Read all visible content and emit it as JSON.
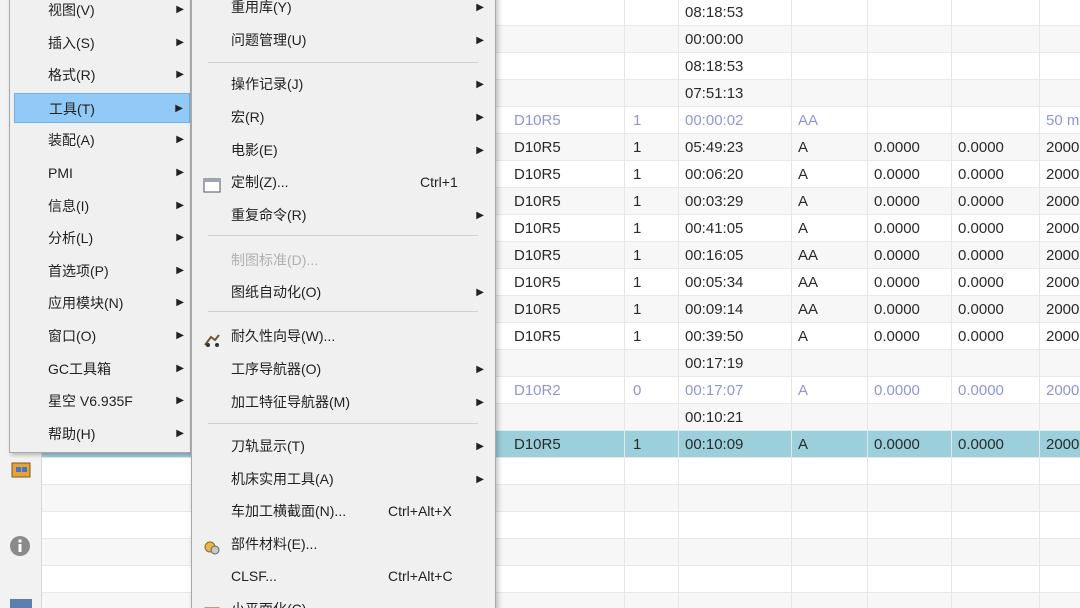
{
  "main_menu": {
    "items": [
      {
        "label": "视图(V)",
        "highlight": false
      },
      {
        "label": "插入(S)",
        "highlight": false
      },
      {
        "label": "格式(R)",
        "highlight": false
      },
      {
        "label": "工具(T)",
        "highlight": true
      },
      {
        "label": "装配(A)",
        "highlight": false
      },
      {
        "label": "PMI",
        "highlight": false
      },
      {
        "label": "信息(I)",
        "highlight": false
      },
      {
        "label": "分析(L)",
        "highlight": false
      },
      {
        "label": "首选项(P)",
        "highlight": false
      },
      {
        "label": "应用模块(N)",
        "highlight": false
      },
      {
        "label": "窗口(O)",
        "highlight": false
      },
      {
        "label": "GC工具箱",
        "highlight": false
      },
      {
        "label": "星空 V6.935F",
        "highlight": false
      },
      {
        "label": "帮助(H)",
        "highlight": false
      }
    ]
  },
  "tools_menu": {
    "items": [
      {
        "label": "重用库(Y)",
        "shortcut": "",
        "submenu": true,
        "disabled": false,
        "icon": ""
      },
      {
        "label": "问题管理(U)",
        "shortcut": "",
        "submenu": true,
        "disabled": false,
        "icon": ""
      },
      {
        "label": "操作记录(J)",
        "shortcut": "",
        "submenu": true,
        "disabled": false,
        "icon": ""
      },
      {
        "label": "宏(R)",
        "shortcut": "",
        "submenu": true,
        "disabled": false,
        "icon": ""
      },
      {
        "label": "电影(E)",
        "shortcut": "",
        "submenu": true,
        "disabled": false,
        "icon": ""
      },
      {
        "label": "定制(Z)...",
        "shortcut": "Ctrl+1",
        "submenu": false,
        "disabled": false,
        "icon": "customize-icon"
      },
      {
        "label": "重复命令(R)",
        "shortcut": "",
        "submenu": true,
        "disabled": false,
        "icon": ""
      },
      {
        "label": "制图标准(D)...",
        "shortcut": "",
        "submenu": false,
        "disabled": true,
        "icon": ""
      },
      {
        "label": "图纸自动化(O)",
        "shortcut": "",
        "submenu": true,
        "disabled": false,
        "icon": ""
      },
      {
        "label": "耐久性向导(W)...",
        "shortcut": "",
        "submenu": false,
        "disabled": false,
        "icon": "durability-wizard-icon"
      },
      {
        "label": "工序导航器(O)",
        "shortcut": "",
        "submenu": true,
        "disabled": false,
        "icon": ""
      },
      {
        "label": "加工特征导航器(M)",
        "shortcut": "",
        "submenu": true,
        "disabled": false,
        "icon": ""
      },
      {
        "label": "刀轨显示(T)",
        "shortcut": "",
        "submenu": true,
        "disabled": false,
        "icon": ""
      },
      {
        "label": "机床实用工具(A)",
        "shortcut": "",
        "submenu": true,
        "disabled": false,
        "icon": ""
      },
      {
        "label": "车加工横截面(N)...",
        "shortcut": "Ctrl+Alt+X",
        "submenu": false,
        "disabled": false,
        "icon": ""
      },
      {
        "label": "部件材料(E)...",
        "shortcut": "",
        "submenu": false,
        "disabled": false,
        "icon": "part-material-icon"
      },
      {
        "label": "CLSF...",
        "shortcut": "Ctrl+Alt+C",
        "submenu": false,
        "disabled": false,
        "icon": ""
      },
      {
        "label": "小平面化(C)",
        "shortcut": "",
        "submenu": false,
        "disabled": false,
        "icon": "faceting-icon"
      }
    ]
  },
  "table": {
    "rows": [
      {
        "tool": "",
        "num": "",
        "time": "08:18:53",
        "type": "",
        "v1": "",
        "v2": "",
        "v3": "",
        "style": "normal"
      },
      {
        "tool": "",
        "num": "",
        "time": "00:00:00",
        "type": "",
        "v1": "",
        "v2": "",
        "v3": "",
        "style": "alt"
      },
      {
        "tool": "",
        "num": "",
        "time": "08:18:53",
        "type": "",
        "v1": "",
        "v2": "",
        "v3": "",
        "style": "normal"
      },
      {
        "tool": "",
        "num": "",
        "time": "07:51:13",
        "type": "",
        "v1": "",
        "v2": "",
        "v3": "",
        "style": "alt"
      },
      {
        "tool": "D10R5",
        "num": "1",
        "time": "00:00:02",
        "type": "AA",
        "v1": "",
        "v2": "",
        "v3": "50 m",
        "style": "dim"
      },
      {
        "tool": "D10R5",
        "num": "1",
        "time": "05:49:23",
        "type": "A",
        "v1": "0.0000",
        "v2": "0.0000",
        "v3": "2000",
        "style": "alt"
      },
      {
        "tool": "D10R5",
        "num": "1",
        "time": "00:06:20",
        "type": "A",
        "v1": "0.0000",
        "v2": "0.0000",
        "v3": "2000",
        "style": "normal"
      },
      {
        "tool": "D10R5",
        "num": "1",
        "time": "00:03:29",
        "type": "A",
        "v1": "0.0000",
        "v2": "0.0000",
        "v3": "2000",
        "style": "alt"
      },
      {
        "tool": "D10R5",
        "num": "1",
        "time": "00:41:05",
        "type": "A",
        "v1": "0.0000",
        "v2": "0.0000",
        "v3": "2000",
        "style": "normal"
      },
      {
        "tool": "D10R5",
        "num": "1",
        "time": "00:16:05",
        "type": "AA",
        "v1": "0.0000",
        "v2": "0.0000",
        "v3": "2000",
        "style": "alt"
      },
      {
        "tool": "D10R5",
        "num": "1",
        "time": "00:05:34",
        "type": "AA",
        "v1": "0.0000",
        "v2": "0.0000",
        "v3": "2000",
        "style": "normal"
      },
      {
        "tool": "D10R5",
        "num": "1",
        "time": "00:09:14",
        "type": "AA",
        "v1": "0.0000",
        "v2": "0.0000",
        "v3": "2000",
        "style": "alt"
      },
      {
        "tool": "D10R5",
        "num": "1",
        "time": "00:39:50",
        "type": "A",
        "v1": "0.0000",
        "v2": "0.0000",
        "v3": "2000",
        "style": "normal"
      },
      {
        "tool": "",
        "num": "",
        "time": "00:17:19",
        "type": "",
        "v1": "",
        "v2": "",
        "v3": "",
        "style": "alt"
      },
      {
        "tool": "D10R2",
        "num": "0",
        "time": "00:17:07",
        "type": "A",
        "v1": "0.0000",
        "v2": "0.0000",
        "v3": "2000",
        "style": "dim"
      },
      {
        "tool": "",
        "num": "",
        "time": "00:10:21",
        "type": "",
        "v1": "",
        "v2": "",
        "v3": "",
        "style": "alt"
      },
      {
        "tool": "D10R5",
        "num": "1",
        "time": "00:10:09",
        "type": "A",
        "v1": "0.0000",
        "v2": "0.0000",
        "v3": "2000",
        "style": "sel"
      },
      {
        "tool": "",
        "num": "",
        "time": "",
        "type": "",
        "v1": "",
        "v2": "",
        "v3": "",
        "style": "normal"
      },
      {
        "tool": "",
        "num": "",
        "time": "",
        "type": "",
        "v1": "",
        "v2": "",
        "v3": "",
        "style": "alt"
      },
      {
        "tool": "",
        "num": "",
        "time": "",
        "type": "",
        "v1": "",
        "v2": "",
        "v3": "",
        "style": "normal"
      },
      {
        "tool": "",
        "num": "",
        "time": "",
        "type": "",
        "v1": "",
        "v2": "",
        "v3": "",
        "style": "alt"
      },
      {
        "tool": "",
        "num": "",
        "time": "",
        "type": "",
        "v1": "",
        "v2": "",
        "v3": "",
        "style": "normal"
      },
      {
        "tool": "",
        "num": "",
        "time": "",
        "type": "",
        "v1": "",
        "v2": "",
        "v3": "",
        "style": "alt"
      }
    ]
  },
  "colors": {
    "menu_bg": "#f0f0f0",
    "menu_highlight": "#91c9f7",
    "row_selected": "#9ccfdc",
    "dim_text": "#8d97d6"
  }
}
